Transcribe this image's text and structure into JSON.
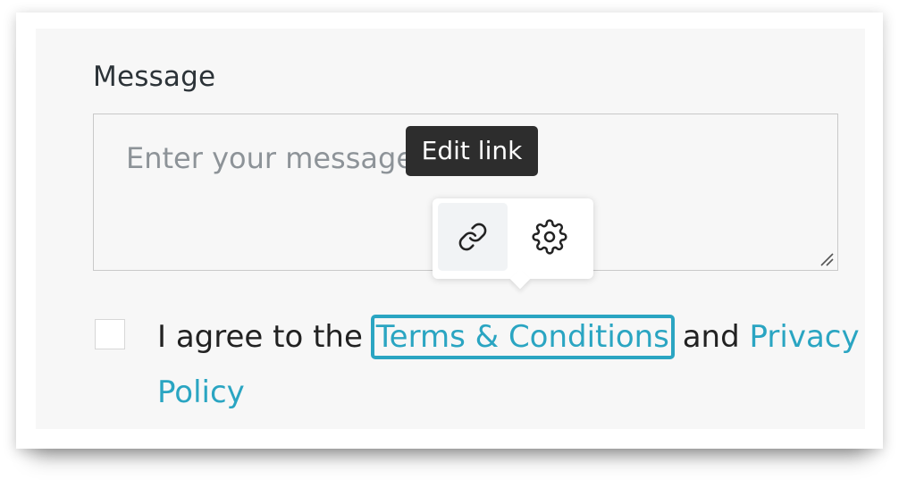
{
  "form": {
    "message_label": "Message",
    "message_placeholder": "Enter your message",
    "tooltip": "Edit link",
    "popover": {
      "link_icon": "link-icon",
      "settings_icon": "gear-icon"
    },
    "agree": {
      "prefix": "I agree to the",
      "terms_link": "Terms & Conditions",
      "conjunction": "and",
      "privacy_link": "Privacy Policy"
    }
  },
  "colors": {
    "link": "#2aa5c2",
    "panel_bg": "#f7f7f7",
    "tooltip_bg": "#2d2d2d"
  }
}
